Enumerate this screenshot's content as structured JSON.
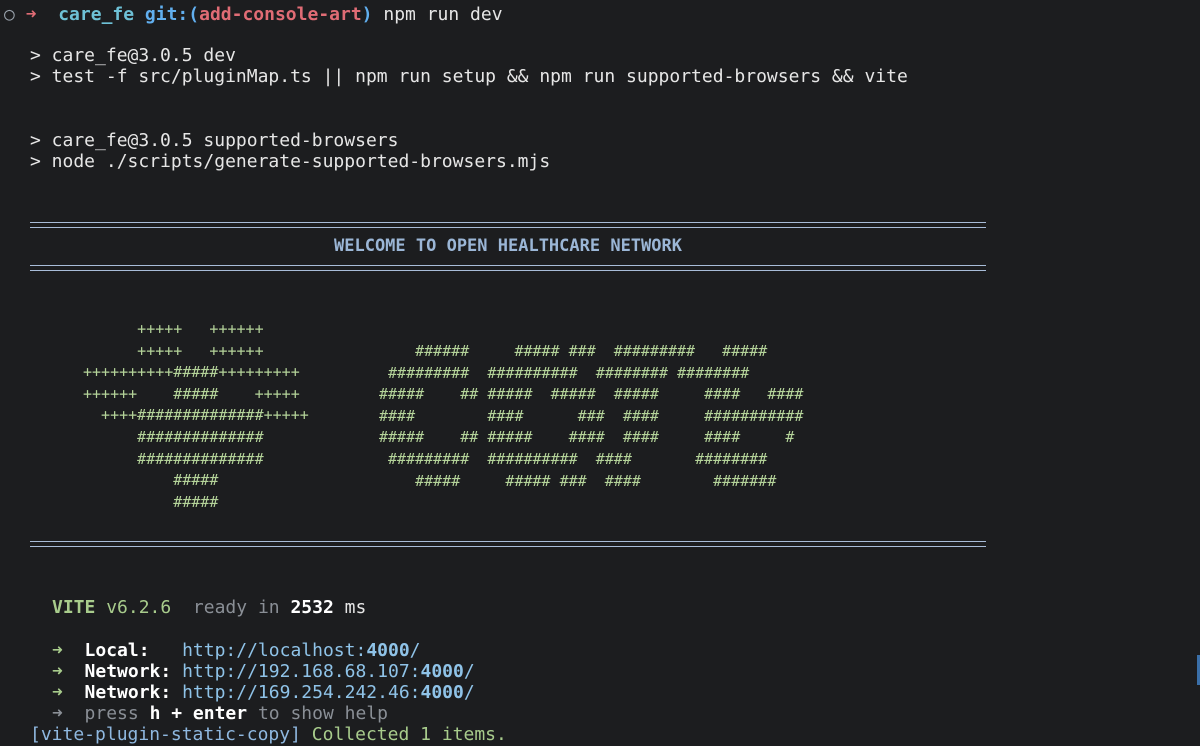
{
  "prompt": {
    "circle": "○",
    "arrow": "➜",
    "dir": "care_fe",
    "git_prefix": "git:(",
    "branch": "add-console-art",
    "git_suffix": ")",
    "command": "npm run dev"
  },
  "output": {
    "dev_line1": "> care_fe@3.0.5 dev",
    "dev_line2": "> test -f src/pluginMap.ts || npm run setup && npm run supported-browsers && vite",
    "sb_line1": "> care_fe@3.0.5 supported-browsers",
    "sb_line2": "> node ./scripts/generate-supported-browsers.mjs"
  },
  "banner": {
    "title": "WELCOME TO OPEN HEALTHCARE NETWORK",
    "cross_art": "      +++++   ++++++\n      +++++   ++++++\n++++++++++#####+++++++++\n++++++    #####    +++++\n  ++++##############+++++\n      ##############\n      ##############\n          #####\n          #####",
    "care_art": "    ######     ##### ###  #########   #####\n #########  ##########  ######## ########\n#####    ## #####  #####  #####     ####   ####\n####        ####      ###  ####     ###########\n#####    ## #####    ####  ####     ####     #\n #########  ##########  ####       ########\n    #####     ##### ###  ####        #######"
  },
  "vite": {
    "name": "VITE",
    "version": "v6.2.6",
    "ready_text": "ready in",
    "ready_ms": "2532",
    "ms_unit": "ms",
    "arrow": "➜",
    "local_label": "Local:",
    "local_url_prefix": "http://localhost:",
    "local_port": "4000",
    "local_slash": "/",
    "network_label": "Network:",
    "network1_url_prefix": "http://192.168.68.107:",
    "network1_port": "4000",
    "network1_slash": "/",
    "network2_url_prefix": "http://169.254.242.46:",
    "network2_port": "4000",
    "network2_slash": "/",
    "help_press": "press",
    "help_key": "h + enter",
    "help_text": "to show help",
    "copy_tag": "[vite-plugin-static-copy]",
    "copy_text": "Collected 1 items."
  }
}
